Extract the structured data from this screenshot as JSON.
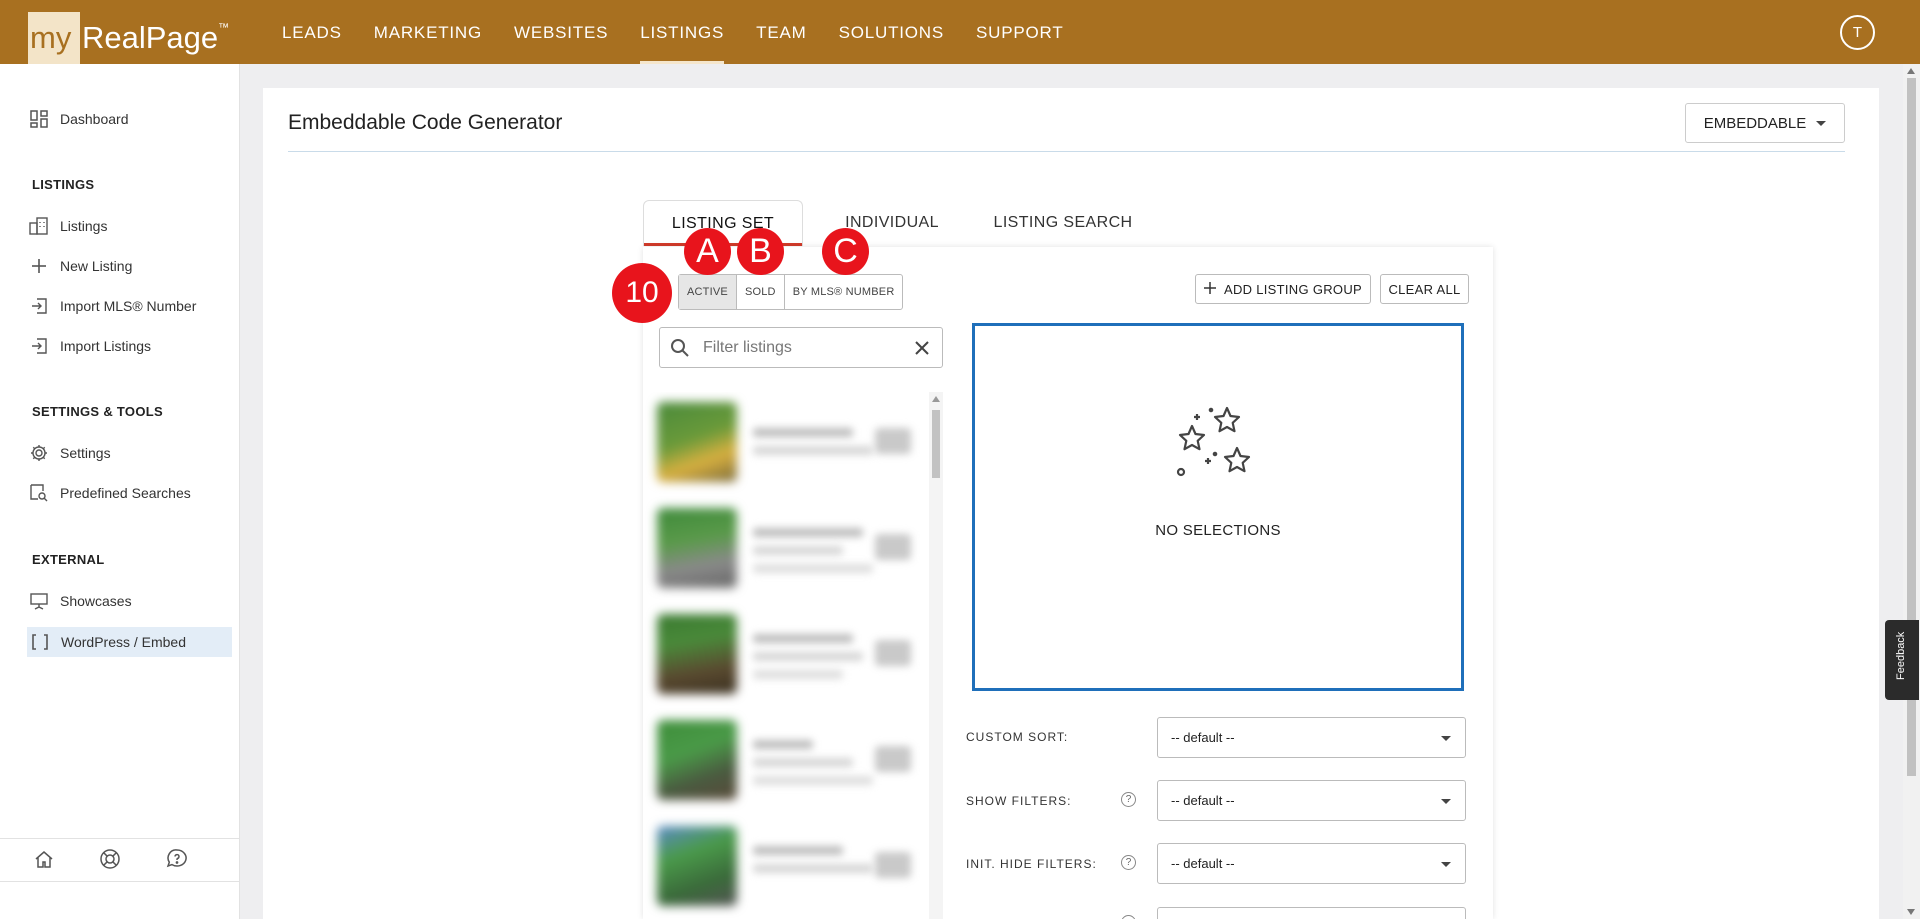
{
  "header": {
    "logo_prefix": "my",
    "logo_name": "RealPage",
    "logo_tm": "™",
    "nav": [
      {
        "label": "LEADS"
      },
      {
        "label": "MARKETING"
      },
      {
        "label": "WEBSITES"
      },
      {
        "label": "LISTINGS",
        "active": true
      },
      {
        "label": "TEAM"
      },
      {
        "label": "SOLUTIONS"
      },
      {
        "label": "SUPPORT"
      }
    ],
    "avatar_initial": "T",
    "brand_color": "#a87020"
  },
  "sidebar": {
    "dashboard": "Dashboard",
    "listings_heading": "LISTINGS",
    "listings_items": [
      "Listings",
      "New Listing",
      "Import MLS® Number",
      "Import Listings"
    ],
    "settings_heading": "SETTINGS & TOOLS",
    "settings_items": [
      "Settings",
      "Predefined Searches"
    ],
    "external_heading": "EXTERNAL",
    "external_items": [
      "Showcases",
      "WordPress / Embed"
    ],
    "selected": "WordPress / Embed",
    "footer_icons": [
      "home-icon",
      "lifebuoy-icon",
      "chat-help-icon"
    ]
  },
  "main": {
    "title": "Embeddable Code Generator",
    "mode_dropdown": "EMBEDDABLE",
    "tabs": [
      {
        "label": "LISTING SET",
        "active": true
      },
      {
        "label": "INDIVIDUAL LISTING"
      },
      {
        "label": "LISTING SEARCH"
      }
    ],
    "status_toggles": [
      {
        "label": "ACTIVE",
        "selected": true
      },
      {
        "label": "SOLD"
      },
      {
        "label": "BY MLS® NUMBER"
      }
    ],
    "add_group_label": "ADD LISTING GROUP",
    "clear_all_label": "CLEAR ALL",
    "filter_placeholder": "Filter listings",
    "empty_selection": "NO SELECTIONS",
    "options": [
      {
        "label": "CUSTOM SORT:",
        "value": "-- default --",
        "help": false
      },
      {
        "label": "SHOW FILTERS:",
        "value": "-- default --",
        "help": true
      },
      {
        "label": "INIT. HIDE FILTERS:",
        "value": "-- default --",
        "help": true
      }
    ]
  },
  "annotations": {
    "step_number": "10",
    "markers": [
      "A",
      "B",
      "C"
    ],
    "color": "#e8141c"
  },
  "feedback_tab": "Feedback"
}
